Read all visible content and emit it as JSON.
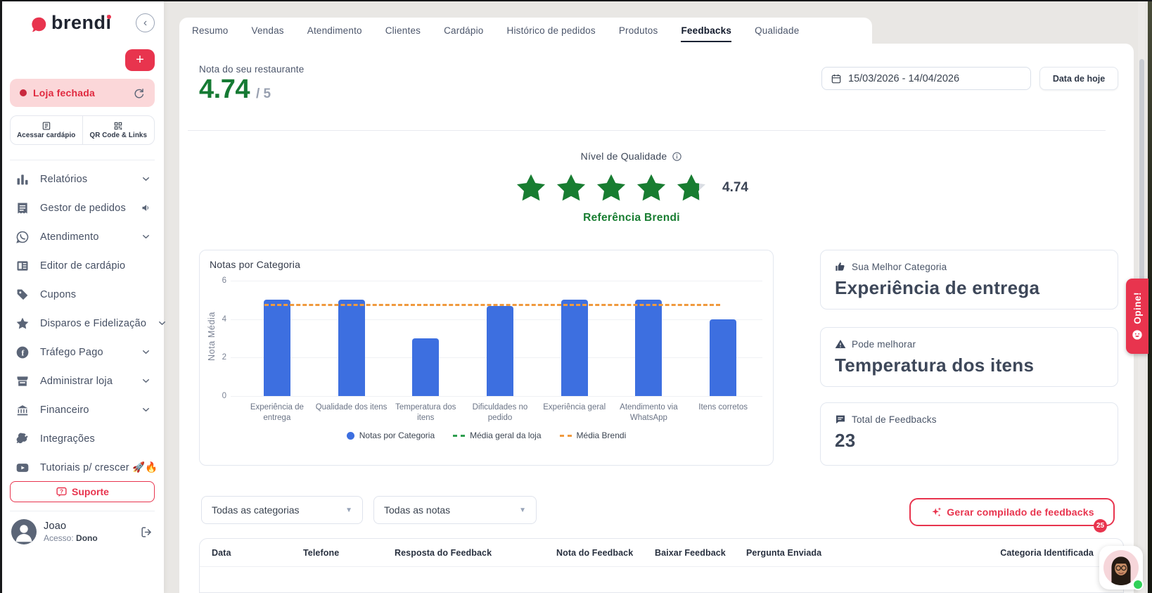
{
  "sidebar": {
    "logo_text": "brendi",
    "status_pill": "Loja fechada",
    "actions": [
      {
        "label": "Acessar cardápio",
        "icon": "menu-card"
      },
      {
        "label": "QR Code & Links",
        "icon": "qr-code"
      }
    ],
    "menu": [
      {
        "label": "Relatórios",
        "icon": "bar-chart",
        "chevron": true
      },
      {
        "label": "Gestor de pedidos",
        "icon": "receipt",
        "trailing": "speaker"
      },
      {
        "label": "Atendimento",
        "icon": "whatsapp",
        "chevron": true
      },
      {
        "label": "Editor de cardápio",
        "icon": "menu-book"
      },
      {
        "label": "Cupons",
        "icon": "tag"
      },
      {
        "label": "Disparos e Fidelização",
        "icon": "star",
        "chevron": true
      },
      {
        "label": "Tráfego Pago",
        "icon": "facebook",
        "chevron": true
      },
      {
        "label": "Administrar loja",
        "icon": "store",
        "chevron": true
      },
      {
        "label": "Financeiro",
        "icon": "bank",
        "chevron": true
      },
      {
        "label": "Integrações",
        "icon": "plug"
      },
      {
        "label": "Tutoriais p/ crescer 🚀🔥",
        "icon": "youtube"
      }
    ],
    "support_label": "Suporte",
    "user": {
      "name": "Joao",
      "access_label": "Acesso:",
      "access_value": "Dono"
    }
  },
  "tabs": [
    "Resumo",
    "Vendas",
    "Atendimento",
    "Clientes",
    "Cardápio",
    "Histórico de pedidos",
    "Produtos",
    "Feedbacks",
    "Qualidade"
  ],
  "active_tab": "Feedbacks",
  "header": {
    "score_label": "Nota do seu restaurante",
    "score": "4.74",
    "score_suffix": "/ 5",
    "date_range": "15/03/2026 - 14/04/2026",
    "today_button": "Data de hoje"
  },
  "quality": {
    "title": "Nível de Qualidade",
    "stars": 4.74,
    "score": "4.74",
    "reference": "Referência Brendi"
  },
  "chart_data": {
    "type": "bar",
    "title": "Notas por Categoria",
    "ylabel": "Nota Média",
    "ylim": [
      0,
      6
    ],
    "yticks": [
      0,
      2,
      4,
      6
    ],
    "categories": [
      "Experiência de entrega",
      "Qualidade dos itens",
      "Temperatura dos itens",
      "Dificuldades no pedido",
      "Experiência geral",
      "Atendimento via WhatsApp",
      "Itens corretos"
    ],
    "values": [
      5,
      5,
      3,
      4.7,
      5,
      5,
      4
    ],
    "bar_color": "#3d6fe0",
    "grid": true,
    "legend_position": "bottom",
    "legend": [
      "Notas por Categoria",
      "Média geral da loja",
      "Média Brendi"
    ],
    "reference_lines": [
      {
        "name": "Média geral da loja",
        "value": 4.74,
        "color": "#2e9e4f",
        "style": "dashed",
        "visible": false
      },
      {
        "name": "Média Brendi",
        "value": 4.75,
        "color": "#f09a3e",
        "style": "dashed",
        "visible": true
      }
    ]
  },
  "cards": [
    {
      "icon": "thumbs-up",
      "label": "Sua Melhor Categoria",
      "value": "Experiência de entrega"
    },
    {
      "icon": "warning",
      "label": "Pode melhorar",
      "value": "Temperatura dos itens"
    },
    {
      "icon": "chat",
      "label": "Total de Feedbacks",
      "value": "23"
    }
  ],
  "filters": {
    "categories": "Todas as categorias",
    "notes": "Todas as notas"
  },
  "generate_button": {
    "label": "Gerar compilado de feedbacks",
    "badge": "25"
  },
  "table": {
    "headers": [
      "Data",
      "Telefone",
      "Resposta do Feedback",
      "Nota do Feedback",
      "Baixar Feedback",
      "Pergunta Enviada",
      "Categoria Identificada"
    ]
  },
  "opine_label": "Opine!",
  "colors": {
    "brand_red": "#e8344e",
    "rating_green": "#187d31",
    "bar_blue": "#3d6fe0",
    "brendi_orange": "#f09a3e",
    "store_avg_green": "#2e9e4f"
  }
}
